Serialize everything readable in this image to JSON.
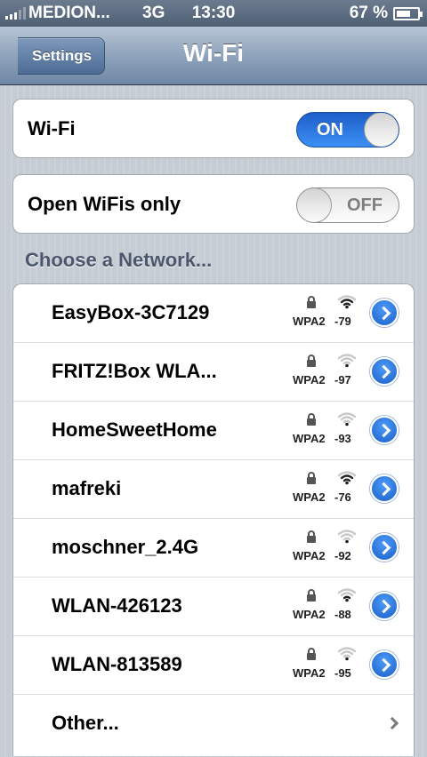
{
  "status_bar": {
    "carrier": "MEDION...",
    "network_type": "3G",
    "time": "13:30",
    "battery_percent": "67 %",
    "battery_level": 0.67
  },
  "nav": {
    "back_label": "Settings",
    "title": "Wi-Fi"
  },
  "wifi_toggle": {
    "label": "Wi-Fi",
    "state": "ON"
  },
  "open_toggle": {
    "label": "Open WiFis only",
    "state": "OFF"
  },
  "section_header": "Choose a Network...",
  "networks": [
    {
      "name": "EasyBox-3C7129",
      "security": "WPA2",
      "rssi": "-79",
      "signal_bars": 3
    },
    {
      "name": "FRITZ!Box WLA...",
      "security": "WPA2",
      "rssi": "-97",
      "signal_bars": 1
    },
    {
      "name": "HomeSweetHome",
      "security": "WPA2",
      "rssi": "-93",
      "signal_bars": 1
    },
    {
      "name": "mafreki",
      "security": "WPA2",
      "rssi": "-76",
      "signal_bars": 3
    },
    {
      "name": "moschner_2.4G",
      "security": "WPA2",
      "rssi": "-92",
      "signal_bars": 1
    },
    {
      "name": "WLAN-426123",
      "security": "WPA2",
      "rssi": "-88",
      "signal_bars": 2
    },
    {
      "name": "WLAN-813589",
      "security": "WPA2",
      "rssi": "-95",
      "signal_bars": 1
    }
  ],
  "other": {
    "label": "Other..."
  },
  "colors": {
    "accent_blue": "#1b5fc9",
    "section_text": "#4c566c",
    "nav_gradient_bottom": "#6f87a5"
  }
}
